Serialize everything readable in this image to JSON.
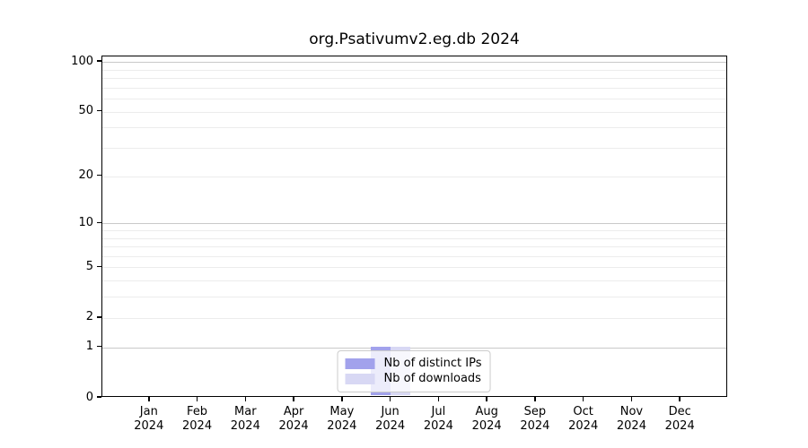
{
  "chart_data": {
    "type": "bar",
    "title": "org.Psativumv2.eg.db 2024",
    "year": "2024",
    "categories": [
      "Jan",
      "Feb",
      "Mar",
      "Apr",
      "May",
      "Jun",
      "Jul",
      "Aug",
      "Sep",
      "Oct",
      "Nov",
      "Dec"
    ],
    "series": [
      {
        "name": "Nb of distinct IPs",
        "color": "#a2a2ec",
        "values": [
          0,
          0,
          0,
          0,
          0,
          1,
          0,
          0,
          0,
          0,
          0,
          0
        ]
      },
      {
        "name": "Nb of downloads",
        "color": "#d8d8f4",
        "values": [
          0,
          0,
          0,
          0,
          0,
          1,
          0,
          0,
          0,
          0,
          0,
          0
        ]
      }
    ],
    "y_scale": "log1p",
    "ylim": [
      0,
      108
    ],
    "y_ticks": [
      0,
      1,
      2,
      5,
      10,
      20,
      50,
      100
    ],
    "grid": {
      "major": [
        1,
        10,
        100
      ],
      "minor": [
        2,
        3,
        4,
        5,
        6,
        7,
        8,
        9,
        20,
        30,
        40,
        50,
        60,
        70,
        80,
        90
      ]
    },
    "legend_position": "lower center",
    "xlabel": "",
    "ylabel": ""
  }
}
